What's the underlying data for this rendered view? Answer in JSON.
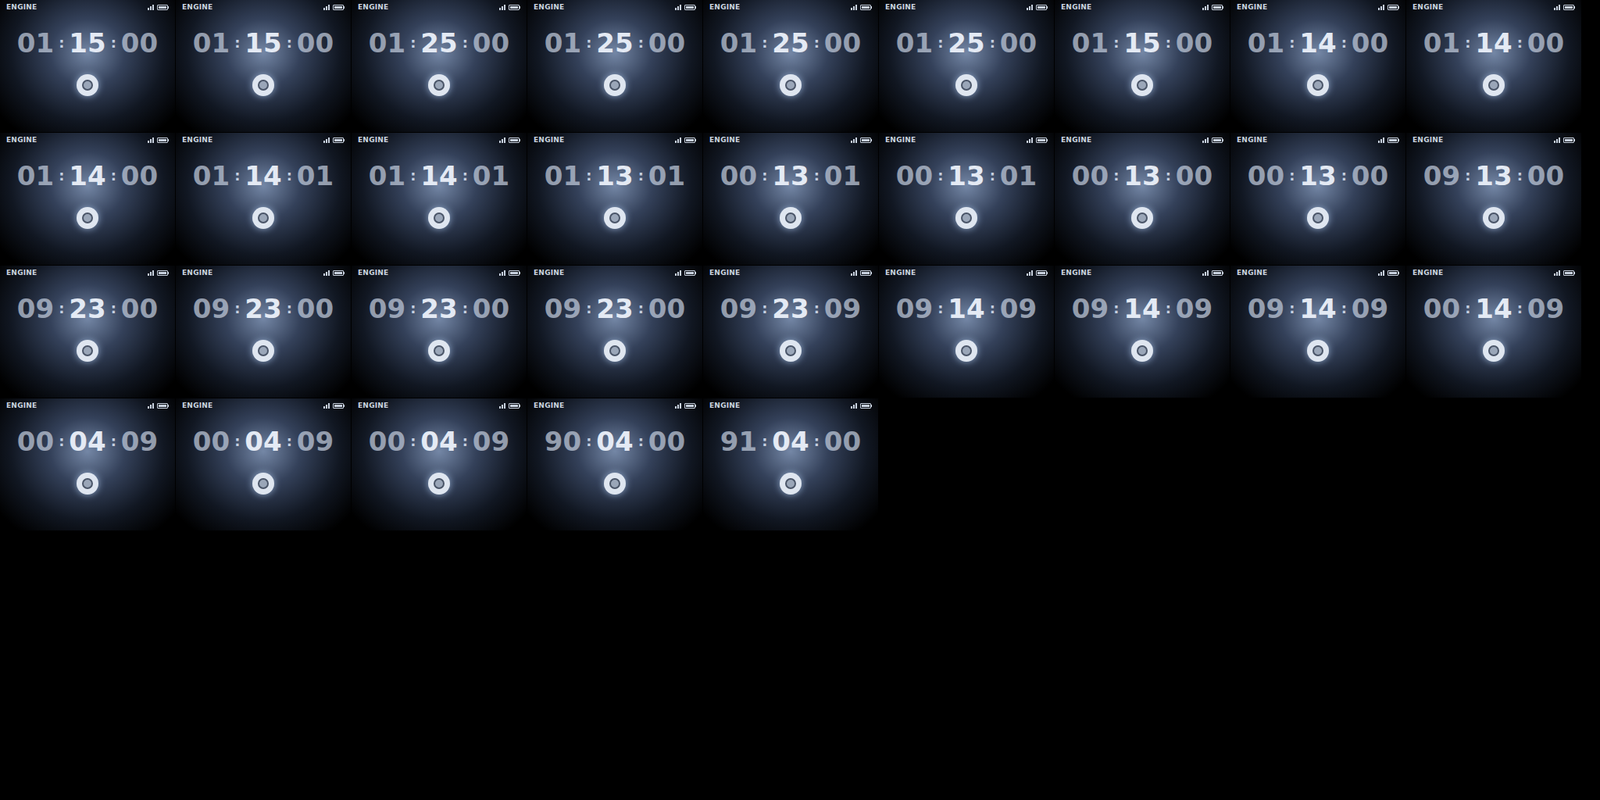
{
  "frames": [
    {
      "label": "ENGINE",
      "hours": "01",
      "minutes": "15",
      "seconds": "00"
    },
    {
      "label": "ENGINE",
      "hours": "01",
      "minutes": "15",
      "seconds": "00"
    },
    {
      "label": "ENGINE",
      "hours": "01",
      "minutes": "25",
      "seconds": "00"
    },
    {
      "label": "ENGINE",
      "hours": "01",
      "minutes": "25",
      "seconds": "00"
    },
    {
      "label": "ENGINE",
      "hours": "01",
      "minutes": "25",
      "seconds": "00"
    },
    {
      "label": "ENGINE",
      "hours": "01",
      "minutes": "25",
      "seconds": "00"
    },
    {
      "label": "ENGINE",
      "hours": "01",
      "minutes": "15",
      "seconds": "00"
    },
    {
      "label": "ENGINE",
      "hours": "01",
      "minutes": "14",
      "seconds": "00"
    },
    {
      "label": "ENGINE",
      "hours": "01",
      "minutes": "14",
      "seconds": "00"
    },
    {
      "label": "ENGINE",
      "hours": "01",
      "minutes": "14",
      "seconds": "00"
    },
    {
      "label": "ENGINE",
      "hours": "01",
      "minutes": "14",
      "seconds": "01"
    },
    {
      "label": "ENGINE",
      "hours": "01",
      "minutes": "14",
      "seconds": "01"
    },
    {
      "label": "ENGINE",
      "hours": "01",
      "minutes": "13",
      "seconds": "01"
    },
    {
      "label": "ENGINE",
      "hours": "00",
      "minutes": "13",
      "seconds": "01"
    },
    {
      "label": "ENGINE",
      "hours": "00",
      "minutes": "13",
      "seconds": "01"
    },
    {
      "label": "ENGINE",
      "hours": "00",
      "minutes": "13",
      "seconds": "00"
    },
    {
      "label": "ENGINE",
      "hours": "00",
      "minutes": "13",
      "seconds": "00"
    },
    {
      "label": "ENGINE",
      "hours": "09",
      "minutes": "13",
      "seconds": "00"
    },
    {
      "label": "ENGINE",
      "hours": "09",
      "minutes": "23",
      "seconds": "00"
    },
    {
      "label": "ENGINE",
      "hours": "09",
      "minutes": "23",
      "seconds": "00"
    },
    {
      "label": "ENGINE",
      "hours": "09",
      "minutes": "23",
      "seconds": "00"
    },
    {
      "label": "ENGINE",
      "hours": "09",
      "minutes": "23",
      "seconds": "00"
    },
    {
      "label": "ENGINE",
      "hours": "09",
      "minutes": "23",
      "seconds": "09"
    },
    {
      "label": "ENGINE",
      "hours": "09",
      "minutes": "14",
      "seconds": "09"
    },
    {
      "label": "ENGINE",
      "hours": "09",
      "minutes": "14",
      "seconds": "09"
    },
    {
      "label": "ENGINE",
      "hours": "09",
      "minutes": "14",
      "seconds": "09"
    },
    {
      "label": "ENGINE",
      "hours": "00",
      "minutes": "14",
      "seconds": "09"
    },
    {
      "label": "ENGINE",
      "hours": "00",
      "minutes": "04",
      "seconds": "09"
    },
    {
      "label": "ENGINE",
      "hours": "00",
      "minutes": "04",
      "seconds": "09"
    },
    {
      "label": "ENGINE",
      "hours": "00",
      "minutes": "04",
      "seconds": "09"
    },
    {
      "label": "ENGINE",
      "hours": "90",
      "minutes": "04",
      "seconds": "00"
    },
    {
      "label": "ENGINE",
      "hours": "91",
      "minutes": "04",
      "seconds": "00"
    }
  ],
  "separator": ":"
}
